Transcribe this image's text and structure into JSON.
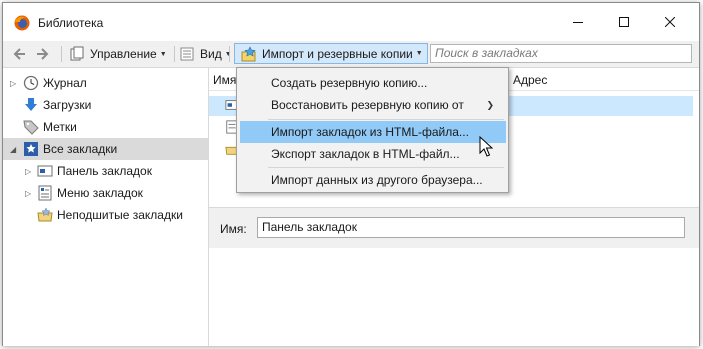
{
  "window": {
    "title": "Библиотека"
  },
  "toolbar": {
    "manage_label": "Управление",
    "view_label": "Вид",
    "import_label": "Импорт и резервные копии",
    "search_placeholder": "Поиск в закладках"
  },
  "sidebar": {
    "items": [
      {
        "label": "Журнал"
      },
      {
        "label": "Загрузки"
      },
      {
        "label": "Метки"
      },
      {
        "label": "Все закладки"
      },
      {
        "label": "Панель закладок"
      },
      {
        "label": "Меню закладок"
      },
      {
        "label": "Неподшитые закладки"
      }
    ]
  },
  "content": {
    "col_name": "Имя",
    "col_address": "Адрес",
    "detail_label": "Имя:",
    "detail_value": "Панель закладок"
  },
  "menu": {
    "items": [
      {
        "label": "Создать резервную копию..."
      },
      {
        "label": "Восстановить резервную копию от"
      },
      {
        "label": "Импорт закладок из HTML-файла..."
      },
      {
        "label": "Экспорт закладок в HTML-файл..."
      },
      {
        "label": "Импорт данных из другого браузера..."
      }
    ]
  },
  "colors": {
    "accent": "#91c9f7",
    "selection": "#cce8ff",
    "toolbar_bg": "#f0f0f0"
  }
}
